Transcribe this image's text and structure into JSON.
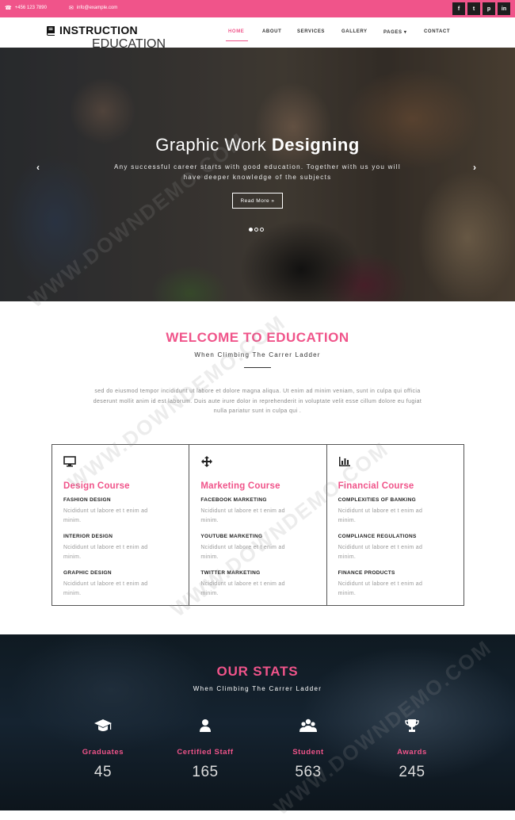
{
  "topbar": {
    "phone": "+456 123 7890",
    "email": "info@example.com",
    "social": [
      "f",
      "t",
      "p",
      "in"
    ]
  },
  "header": {
    "logo_name": "INSTRUCTION",
    "logo_sub": "EDUCATION",
    "nav": [
      {
        "label": "HOME",
        "active": true
      },
      {
        "label": "ABOUT"
      },
      {
        "label": "SERVICES"
      },
      {
        "label": "GALLERY"
      },
      {
        "label": "PAGES ▾"
      },
      {
        "label": "CONTACT"
      }
    ]
  },
  "hero": {
    "title_plain": "Graphic Work ",
    "title_bold": "Designing",
    "description": "Any successful career starts with good education. Together with us you will have deeper knowledge of the subjects",
    "button": "Read More »",
    "prev": "‹",
    "next": "›"
  },
  "welcome": {
    "title": "WELCOME TO EDUCATION",
    "subtitle": "When Climbing The Carrer Ladder",
    "text": "sed do eiusmod tempor incididunt ut labore et dolore magna aliqua. Ut enim ad minim veniam, sunt in culpa qui officia deserunt mollit anim id est laborum. Duis aute irure dolor in reprehenderit in voluptate velit esse cillum dolore eu fugiat nulla pariatur sunt in culpa qui ."
  },
  "courses": [
    {
      "icon": "monitor-icon",
      "title": "Design Course",
      "items": [
        {
          "heading": "FASHION DESIGN",
          "text": "Ncididunt ut labore et t enim ad minim."
        },
        {
          "heading": "INTERIOR DESIGN",
          "text": "Ncididunt ut labore et t enim ad minim."
        },
        {
          "heading": "GRAPHIC DESIGN",
          "text": "Ncididunt ut labore et t enim ad minim."
        }
      ]
    },
    {
      "icon": "move-arrows-icon",
      "title": "Marketing Course",
      "items": [
        {
          "heading": "FACEBOOK MARKETING",
          "text": "Ncididunt ut labore et t enim ad minim."
        },
        {
          "heading": "YOUTUBE MARKETING",
          "text": "Ncididunt ut labore et t enim ad minim."
        },
        {
          "heading": "TWITTER MARKETING",
          "text": "Ncididunt ut labore et t enim ad minim."
        }
      ]
    },
    {
      "icon": "bar-chart-icon",
      "title": "Financial Course",
      "items": [
        {
          "heading": "COMPLEXITIES OF BANKING",
          "text": "Ncididunt ut labore et t enim ad minim."
        },
        {
          "heading": "COMPLIANCE REGULATIONS",
          "text": "Ncididunt ut labore et t enim ad minim."
        },
        {
          "heading": "FINANCE PRODUCTS",
          "text": "Ncididunt ut labore et t enim ad minim."
        }
      ]
    }
  ],
  "stats": {
    "title": "OUR STATS",
    "subtitle": "When Climbing The Carrer Ladder",
    "items": [
      {
        "icon": "graduation-cap-icon",
        "label": "Graduates",
        "value": "45"
      },
      {
        "icon": "user-icon",
        "label": "Certified Staff",
        "value": "165"
      },
      {
        "icon": "users-icon",
        "label": "Student",
        "value": "563"
      },
      {
        "icon": "trophy-icon",
        "label": "Awards",
        "value": "245"
      }
    ]
  },
  "watermark": "WWW.DOWNDEMO.COM",
  "colors": {
    "accent": "#f0548a",
    "dark": "#1e1e1e"
  }
}
